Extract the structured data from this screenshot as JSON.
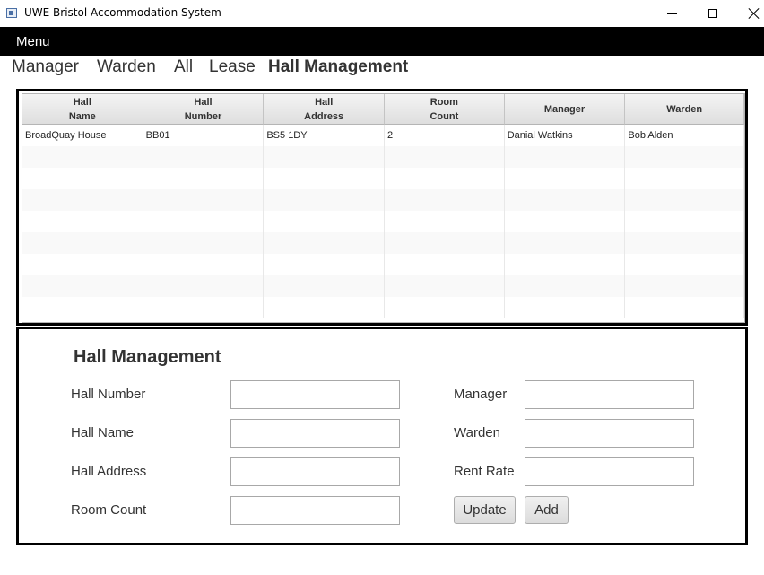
{
  "window": {
    "title": "UWE Bristol Accommodation System",
    "icons": [
      "app-icon",
      "minimize-icon",
      "maximize-icon",
      "close-icon"
    ]
  },
  "menubar": {
    "menu_label": "Menu"
  },
  "nav": {
    "items": [
      {
        "label": "Manager",
        "active": false
      },
      {
        "label": "Warden",
        "active": false
      },
      {
        "label": "All",
        "active": false
      },
      {
        "label": "Lease",
        "active": false
      },
      {
        "label": "Hall Management",
        "active": true
      }
    ]
  },
  "table": {
    "columns": [
      "Hall\nName",
      "Hall\nNumber",
      "Hall\nAddress",
      "Room\nCount",
      "Manager",
      "Warden"
    ],
    "rows": [
      [
        "BroadQuay House",
        "BB01",
        "BS5 1DY",
        "2",
        "Danial Watkins",
        "Bob Alden"
      ]
    ]
  },
  "form": {
    "title": "Hall Management",
    "left_fields": [
      {
        "label": "Hall Number",
        "value": ""
      },
      {
        "label": "Hall Name",
        "value": ""
      },
      {
        "label": "Hall Address",
        "value": ""
      },
      {
        "label": "Room Count",
        "value": ""
      }
    ],
    "right_fields": [
      {
        "label": "Manager",
        "value": ""
      },
      {
        "label": "Warden",
        "value": ""
      },
      {
        "label": "Rent Rate",
        "value": ""
      }
    ],
    "update_label": "Update",
    "add_label": "Add"
  }
}
